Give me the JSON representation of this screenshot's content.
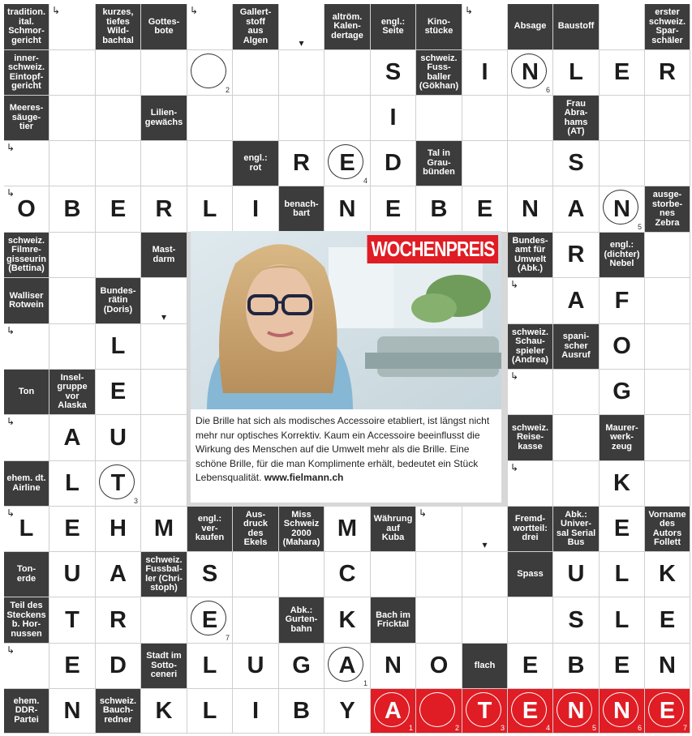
{
  "puzzle": {
    "rows": [
      [
        {
          "t": "c",
          "c": "tradition.\nital.\nSchmor-\ngericht"
        },
        {
          "t": "l",
          "a": "corner"
        },
        {
          "t": "c",
          "c": "kurzes,\ntiefes\nWild-\nbachtal"
        },
        {
          "t": "c",
          "c": "Gottes-\nbote"
        },
        {
          "t": "l",
          "a": "corner"
        },
        {
          "t": "c",
          "c": "Gallert-\nstoff\naus\nAlgen"
        },
        {
          "t": "l",
          "a": "down"
        },
        {
          "t": "c",
          "c": "altröm.\nKalen-\ndertage"
        },
        {
          "t": "c",
          "c": "engl.:\nSeite"
        },
        {
          "t": "c",
          "c": "Kino-\nstücke"
        },
        {
          "t": "l",
          "a": "corner"
        },
        {
          "t": "c",
          "c": "Absage"
        },
        {
          "t": "c",
          "c": "Baustoff"
        },
        {
          "t": "l"
        },
        {
          "t": "c",
          "c": "erster\nschweiz.\nSpar-\nschäler"
        }
      ],
      [
        {
          "t": "c",
          "c": "inner-\nschweiz.\nEintopf-\ngericht"
        },
        {
          "t": "l"
        },
        {
          "t": "l"
        },
        {
          "t": "l"
        },
        {
          "t": "l",
          "circ": true,
          "n": "2"
        },
        {
          "t": "l"
        },
        {
          "t": "l"
        },
        {
          "t": "l"
        },
        {
          "t": "l",
          "v": "S"
        },
        {
          "t": "c",
          "c": "schweiz.\nFuss-\nballer\n(Gökhan)"
        },
        {
          "t": "l",
          "v": "I"
        },
        {
          "t": "l",
          "v": "N",
          "circ": true,
          "n": "6"
        },
        {
          "t": "l",
          "v": "L"
        },
        {
          "t": "l",
          "v": "E"
        },
        {
          "t": "l",
          "v": "R"
        }
      ],
      [
        {
          "t": "c",
          "c": "Meeres-\nsäuge-\ntier"
        },
        {
          "t": "l"
        },
        {
          "t": "l"
        },
        {
          "t": "c",
          "c": "Lilien-\ngewächs"
        },
        {
          "t": "l"
        },
        {
          "t": "l"
        },
        {
          "t": "l"
        },
        {
          "t": "l"
        },
        {
          "t": "l",
          "v": "I"
        },
        {
          "t": "l"
        },
        {
          "t": "l"
        },
        {
          "t": "l"
        },
        {
          "t": "c",
          "c": "Frau\nAbra-\nhams\n(AT)"
        },
        {
          "t": "l"
        },
        {
          "t": "l"
        }
      ],
      [
        {
          "t": "l",
          "a": "corner"
        },
        {
          "t": "l"
        },
        {
          "t": "l"
        },
        {
          "t": "l"
        },
        {
          "t": "l"
        },
        {
          "t": "c",
          "c": "engl.:\nrot"
        },
        {
          "t": "l",
          "v": "R"
        },
        {
          "t": "l",
          "v": "E",
          "circ": true,
          "n": "4"
        },
        {
          "t": "l",
          "v": "D"
        },
        {
          "t": "c",
          "c": "Tal in\nGrau-\nbünden"
        },
        {
          "t": "l"
        },
        {
          "t": "l"
        },
        {
          "t": "l",
          "v": "S"
        },
        {
          "t": "l"
        },
        {
          "t": "l"
        }
      ],
      [
        {
          "t": "l",
          "v": "O",
          "a": "corner"
        },
        {
          "t": "l",
          "v": "B"
        },
        {
          "t": "l",
          "v": "E"
        },
        {
          "t": "l",
          "v": "R"
        },
        {
          "t": "l",
          "v": "L"
        },
        {
          "t": "l",
          "v": "I"
        },
        {
          "t": "c",
          "c": "benach-\nbart"
        },
        {
          "t": "l",
          "v": "N"
        },
        {
          "t": "l",
          "v": "E"
        },
        {
          "t": "l",
          "v": "B"
        },
        {
          "t": "l",
          "v": "E"
        },
        {
          "t": "l",
          "v": "N"
        },
        {
          "t": "l",
          "v": "A"
        },
        {
          "t": "l",
          "v": "N",
          "circ": true,
          "n": "5"
        },
        {
          "t": "c",
          "c": "ausge-\nstorbe-\nnes\nZebra"
        }
      ],
      [
        {
          "t": "c",
          "c": "schweiz.\nFilmre-\ngisseurin\n(Bettina)"
        },
        {
          "t": "l"
        },
        {
          "t": "l"
        },
        {
          "t": "c",
          "c": "Mast-\ndarm"
        },
        {
          "t": "x"
        },
        {
          "t": "x"
        },
        {
          "t": "x"
        },
        {
          "t": "x"
        },
        {
          "t": "x"
        },
        {
          "t": "x"
        },
        {
          "t": "x"
        },
        {
          "t": "c",
          "c": "Bundes-\namt für\nUmwelt\n(Abk.)"
        },
        {
          "t": "l",
          "v": "R"
        },
        {
          "t": "c",
          "c": "engl.:\n(dichter)\nNebel"
        },
        {
          "t": "l"
        }
      ],
      [
        {
          "t": "c",
          "c": "Walliser\nRotwein"
        },
        {
          "t": "l"
        },
        {
          "t": "c",
          "c": "Bundes-\nrätin\n(Doris)"
        },
        {
          "t": "l",
          "a": "down"
        },
        {
          "t": "x"
        },
        {
          "t": "x"
        },
        {
          "t": "x"
        },
        {
          "t": "x"
        },
        {
          "t": "x"
        },
        {
          "t": "x"
        },
        {
          "t": "x"
        },
        {
          "t": "l",
          "a": "corner"
        },
        {
          "t": "l",
          "v": "A"
        },
        {
          "t": "l",
          "v": "F"
        },
        {
          "t": "l"
        }
      ],
      [
        {
          "t": "l",
          "a": "corner"
        },
        {
          "t": "l"
        },
        {
          "t": "l",
          "v": "L"
        },
        {
          "t": "l"
        },
        {
          "t": "x"
        },
        {
          "t": "x"
        },
        {
          "t": "x"
        },
        {
          "t": "x"
        },
        {
          "t": "x"
        },
        {
          "t": "x"
        },
        {
          "t": "x"
        },
        {
          "t": "c",
          "c": "schweiz.\nSchau-\nspieler\n(Andrea)"
        },
        {
          "t": "c",
          "c": "spani-\nscher\nAusruf"
        },
        {
          "t": "l",
          "v": "O"
        },
        {
          "t": "l"
        }
      ],
      [
        {
          "t": "c",
          "c": "Ton"
        },
        {
          "t": "c",
          "c": "Insel-\ngruppe\nvor\nAlaska"
        },
        {
          "t": "l",
          "v": "E"
        },
        {
          "t": "l"
        },
        {
          "t": "x"
        },
        {
          "t": "x"
        },
        {
          "t": "x"
        },
        {
          "t": "x"
        },
        {
          "t": "x"
        },
        {
          "t": "x"
        },
        {
          "t": "x"
        },
        {
          "t": "l",
          "a": "corner"
        },
        {
          "t": "l"
        },
        {
          "t": "l",
          "v": "G"
        },
        {
          "t": "l"
        }
      ],
      [
        {
          "t": "l",
          "a": "corner"
        },
        {
          "t": "l",
          "v": "A"
        },
        {
          "t": "l",
          "v": "U"
        },
        {
          "t": "l"
        },
        {
          "t": "x"
        },
        {
          "t": "x"
        },
        {
          "t": "x"
        },
        {
          "t": "x"
        },
        {
          "t": "x"
        },
        {
          "t": "x"
        },
        {
          "t": "x"
        },
        {
          "t": "c",
          "c": "schweiz.\nReise-\nkasse"
        },
        {
          "t": "l"
        },
        {
          "t": "c",
          "c": "Maurer-\nwerk-\nzeug"
        },
        {
          "t": "l"
        }
      ],
      [
        {
          "t": "c",
          "c": "ehem. dt.\nAirline"
        },
        {
          "t": "l",
          "v": "L"
        },
        {
          "t": "l",
          "v": "T",
          "circ": true,
          "n": "3"
        },
        {
          "t": "l"
        },
        {
          "t": "x"
        },
        {
          "t": "x"
        },
        {
          "t": "x"
        },
        {
          "t": "x"
        },
        {
          "t": "x"
        },
        {
          "t": "x"
        },
        {
          "t": "x"
        },
        {
          "t": "l",
          "a": "corner"
        },
        {
          "t": "l"
        },
        {
          "t": "l",
          "v": "K"
        },
        {
          "t": "l"
        }
      ],
      [
        {
          "t": "l",
          "v": "L",
          "a": "corner"
        },
        {
          "t": "l",
          "v": "E"
        },
        {
          "t": "l",
          "v": "H"
        },
        {
          "t": "l",
          "v": "M"
        },
        {
          "t": "c",
          "c": "engl.:\nver-\nkaufen"
        },
        {
          "t": "c",
          "c": "Aus-\ndruck\ndes\nEkels"
        },
        {
          "t": "c",
          "c": "Miss\nSchweiz\n2000\n(Mahara)"
        },
        {
          "t": "l",
          "v": "M"
        },
        {
          "t": "c",
          "c": "Währung\nauf\nKuba"
        },
        {
          "t": "l",
          "a": "corner"
        },
        {
          "t": "l",
          "a": "down"
        },
        {
          "t": "c",
          "c": "Fremd-\nwortteil:\ndrei"
        },
        {
          "t": "c",
          "c": "Abk.:\nUniver-\nsal Serial\nBus"
        },
        {
          "t": "l",
          "v": "E"
        },
        {
          "t": "c",
          "c": "Vorname\ndes\nAutors\nFollett"
        }
      ],
      [
        {
          "t": "c",
          "c": "Ton-\nerde"
        },
        {
          "t": "l",
          "v": "U"
        },
        {
          "t": "l",
          "v": "A"
        },
        {
          "t": "c",
          "c": "schweiz.\nFussbal-\nler (Chri-\nstoph)"
        },
        {
          "t": "l",
          "v": "S"
        },
        {
          "t": "l"
        },
        {
          "t": "l"
        },
        {
          "t": "l",
          "v": "C"
        },
        {
          "t": "l"
        },
        {
          "t": "l"
        },
        {
          "t": "l"
        },
        {
          "t": "c",
          "c": "Spass"
        },
        {
          "t": "l",
          "v": "U"
        },
        {
          "t": "l",
          "v": "L"
        },
        {
          "t": "l",
          "v": "K"
        }
      ],
      [
        {
          "t": "c",
          "c": "Teil des\nSteckens\nb. Hor-\nnussen"
        },
        {
          "t": "l",
          "v": "T"
        },
        {
          "t": "l",
          "v": "R"
        },
        {
          "t": "l"
        },
        {
          "t": "l",
          "v": "E",
          "circ": true,
          "n": "7"
        },
        {
          "t": "l"
        },
        {
          "t": "c",
          "c": "Abk.:\nGurten-\nbahn"
        },
        {
          "t": "l",
          "v": "K"
        },
        {
          "t": "c",
          "c": "Bach im\nFricktal"
        },
        {
          "t": "l"
        },
        {
          "t": "l"
        },
        {
          "t": "l"
        },
        {
          "t": "l",
          "v": "S"
        },
        {
          "t": "l",
          "v": "L"
        },
        {
          "t": "l",
          "v": "E"
        }
      ],
      [
        {
          "t": "l",
          "a": "corner"
        },
        {
          "t": "l",
          "v": "E"
        },
        {
          "t": "l",
          "v": "D"
        },
        {
          "t": "c",
          "c": "Stadt im\nSotto-\nceneri"
        },
        {
          "t": "l",
          "v": "L"
        },
        {
          "t": "l",
          "v": "U"
        },
        {
          "t": "l",
          "v": "G"
        },
        {
          "t": "l",
          "v": "A",
          "circ": true,
          "n": "1"
        },
        {
          "t": "l",
          "v": "N"
        },
        {
          "t": "l",
          "v": "O"
        },
        {
          "t": "c",
          "c": "flach"
        },
        {
          "t": "l",
          "v": "E"
        },
        {
          "t": "l",
          "v": "B"
        },
        {
          "t": "l",
          "v": "E"
        },
        {
          "t": "l",
          "v": "N"
        }
      ],
      [
        {
          "t": "c",
          "c": "ehem.\nDDR-\nPartei"
        },
        {
          "t": "l",
          "v": "N"
        },
        {
          "t": "c",
          "c": "schweiz.\nBauch-\nredner"
        },
        {
          "t": "l",
          "v": "K"
        },
        {
          "t": "l",
          "v": "L"
        },
        {
          "t": "l",
          "v": "I"
        },
        {
          "t": "l",
          "v": "B"
        },
        {
          "t": "l",
          "v": "Y"
        },
        {
          "t": "s",
          "v": "A",
          "n": "1"
        },
        {
          "t": "s",
          "v": "",
          "n": "2"
        },
        {
          "t": "s",
          "v": "T",
          "n": "3"
        },
        {
          "t": "s",
          "v": "E",
          "n": "4"
        },
        {
          "t": "s",
          "v": "N",
          "n": "5"
        },
        {
          "t": "s",
          "v": "N",
          "n": "6"
        },
        {
          "t": "s",
          "v": "E",
          "n": "7"
        }
      ]
    ]
  },
  "prize": {
    "badge": "WOCHENPREIS",
    "text": "Die Brille hat sich als modisches Accessoire etabliert, ist längst nicht mehr nur optisches Korrektiv. Kaum ein Accessoire beeinflusst die Wirkung des Menschen auf die Umwelt mehr als die Brille. Eine schöne Brille, für die man Komplimente erhält, bedeutet ein Stück Lebensqualität.",
    "link": "www.fielmann.ch"
  },
  "icons": {
    "arrow_right": "arrow-right-icon",
    "arrow_down": "arrow-down-icon",
    "arrow_corner": "arrow-corner-icon"
  },
  "colors": {
    "clue_bg": "#3c3c3c",
    "solution_bg": "#e01c24",
    "badge_bg": "#e01c24"
  }
}
